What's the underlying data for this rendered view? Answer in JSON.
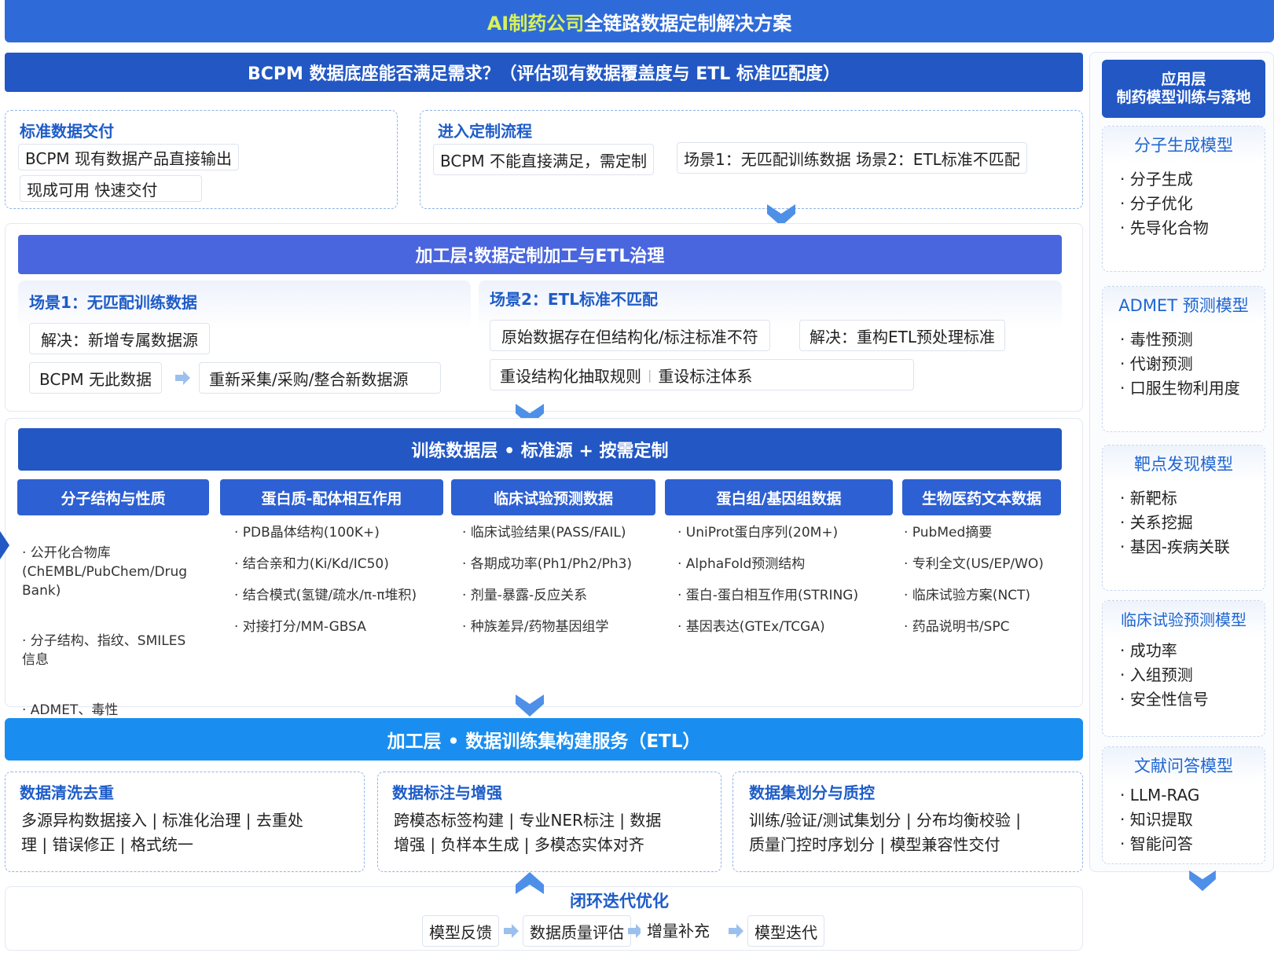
{
  "title": {
    "highlight": "AI制药公司",
    "rest": "全链路数据定制解决方案"
  },
  "question_bar": "BCPM 数据底座能否满足需求？（评估现有数据覆盖度与 ETL 标准匹配度）",
  "standard": {
    "title": "标准数据交付",
    "chips": [
      "BCPM 现有数据产品直接输出",
      "现成可用 快速交付"
    ]
  },
  "custom": {
    "title": "进入定制流程",
    "chips": [
      "BCPM 不能直接满足，需定制",
      "场景1：无匹配训练数据 场景2：ETL标准不匹配"
    ]
  },
  "processing": {
    "header": "加工层:数据定制加工与ETL治理",
    "scene1": {
      "title": "场景1：无匹配训练数据",
      "solution": "解决：新增专属数据源",
      "from": "BCPM 无此数据",
      "to": "重新采集/采购/整合新数据源"
    },
    "scene2": {
      "title": "场景2：ETL标准不匹配",
      "problem": "原始数据存在但结构化/标注标准不符",
      "solution": "解决：重构ETL预处理标准",
      "step1": "重设结构化抽取规则",
      "sep": "|",
      "step2": "重设标注体系"
    }
  },
  "training": {
    "header": "训练数据层 • 标准源 + 按需定制",
    "columns": [
      {
        "title": "分子结构与性质",
        "items": [
          "· 公开化合物库\n(ChEMBL/PubChem/Drug\nBank)",
          "· 分子结构、指纹、SMILES\n信息",
          "· ADMET、毒性\n可合成性标注"
        ]
      },
      {
        "title": "蛋白质-配体相互作用",
        "items": [
          "· PDB晶体结构(100K+)",
          "· 结合亲和力(Ki/Kd/IC50)",
          "· 结合模式(氢键/疏水/π-π堆积)",
          "· 对接打分/MM-GBSA"
        ]
      },
      {
        "title": "临床试验预测数据",
        "items": [
          "· 临床试验结果(PASS/FAIL)",
          "· 各期成功率(Ph1/Ph2/Ph3)",
          "· 剂量-暴露-反应关系",
          "· 种族差异/药物基因组学"
        ]
      },
      {
        "title": "蛋白组/基因组数据",
        "items": [
          "· UniProt蛋白序列(20M+)",
          "· AlphaFold预测结构",
          "· 蛋白-蛋白相互作用(STRING)",
          "· 基因表达(GTEx/TCGA)"
        ]
      },
      {
        "title": "生物医药文本数据",
        "items": [
          "· PubMed摘要",
          "· 专利全文(US/EP/WO)",
          "· 临床试验方案(NCT)",
          "· 药品说明书/SPC"
        ]
      }
    ]
  },
  "etl": {
    "header": "加工层 • 数据训练集构建服务（ETL）",
    "boxes": [
      {
        "title": "数据清洗去重",
        "text": "多源异构数据接入 | 标准化治理 | 去重处\n理 | 错误修正 | 格式统一"
      },
      {
        "title": "数据标注与增强",
        "text": "跨模态标签构建 | 专业NER标注 | 数据\n增强 | 负样本生成 | 多模态实体对齐"
      },
      {
        "title": "数据集划分与质控",
        "text": "训练/验证/测试集划分 | 分布均衡校验 |\n质量门控时序划分 | 模型兼容性交付"
      }
    ]
  },
  "loop": {
    "title": "闭环迭代优化",
    "steps": [
      "模型反馈",
      "数据质量评估",
      "增量补充",
      "模型迭代"
    ]
  },
  "app": {
    "header": "应用层\n制药模型训练与落地",
    "cards": [
      {
        "title": "分子生成模型",
        "items": [
          "· 分子生成",
          "· 分子优化",
          "· 先导化合物"
        ]
      },
      {
        "title": "ADMET 预测模型",
        "items": [
          "· 毒性预测",
          "· 代谢预测",
          "· 口服生物利用度"
        ]
      },
      {
        "title": "靶点发现模型",
        "items": [
          "· 新靶标",
          "· 关系挖掘",
          "· 基因-疾病关联"
        ]
      },
      {
        "title": "临床试验预测模型",
        "items": [
          "· 成功率",
          "· 入组预测",
          "· 安全性信号"
        ]
      },
      {
        "title": "文献问答模型",
        "items": [
          "· LLM-RAG",
          "· 知识提取",
          "· 智能问答"
        ]
      }
    ]
  }
}
